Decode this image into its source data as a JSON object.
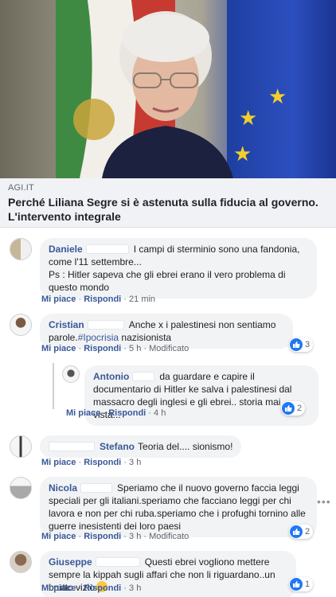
{
  "article": {
    "domain": "AGI.IT",
    "title": "Perché Liliana Segre si è astenuta sulla fiducia al governo. L'intervento integrale"
  },
  "comments": [
    {
      "name": "Daniele",
      "text": "I campi di sterminio sono una fandonia, come l'11 settembre...",
      "text2": "Ps : Hitler sapeva che gli ebrei erano il vero problema di questo mondo",
      "like": "Mi piace",
      "reply": "Rispondi",
      "time": "21 min"
    },
    {
      "name": "Cristian",
      "text_a": "Anche x i palestinesi non sentiamo parole.",
      "hashtag": "#Ipocrisia",
      "text_b": " nazisionista",
      "like": "Mi piace",
      "reply": "Rispondi",
      "time": "5 h",
      "edited": "Modificato",
      "reactions": "3"
    },
    {
      "name": "Antonio",
      "text": "da guardare e capire il documentario di Hitler ke salva i palestinesi dal massacro degli inglesi e gli ebrei.. storia mai vista...",
      "like": "Mi piace",
      "reply": "Rispondi",
      "time": "4 h",
      "reactions": "2"
    },
    {
      "name": "Stefano",
      "text": "Teoria del.... sionismo!",
      "like": "Mi piace",
      "reply": "Rispondi",
      "time": "3 h"
    },
    {
      "name": "Nicola",
      "text": "Speriamo che il nuovo governo faccia leggi speciali per gli italiani.speriamo che facciano leggi per chi lavora e non per chi ruba.speriamo che i profughi tornino alle guerre inesistenti dei loro paesi",
      "like": "Mi piace",
      "reply": "Rispondi",
      "time": "3 h",
      "edited": "Modificato",
      "reactions": "2"
    },
    {
      "name": "Giuseppe",
      "text": "Questi ebrei vogliono mettere sempre la kippah sugli affari che non li riguardano..un brutto vizio",
      "like": "Mi piace",
      "reply": "Rispondi",
      "time": "3 h",
      "reactions": "1"
    }
  ],
  "ui": {
    "separator": " · ",
    "more": "•••"
  },
  "icons": {
    "like": "thumbs-up-icon",
    "more": "more-options-icon"
  },
  "colors": {
    "link_blue": "#385898",
    "reaction_blue": "#2078f4",
    "bubble": "#f2f3f5"
  }
}
